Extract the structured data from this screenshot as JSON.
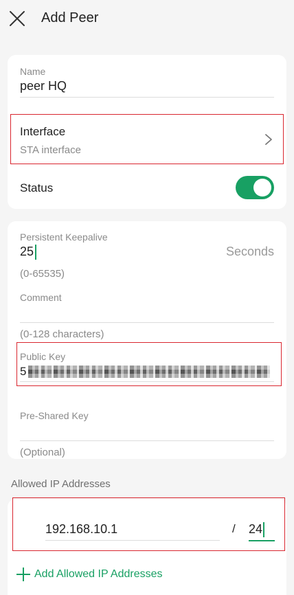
{
  "header": {
    "title": "Add Peer"
  },
  "general": {
    "name_label": "Name",
    "name_value": "peer HQ",
    "interface_label": "Interface",
    "interface_value": "STA interface",
    "status_label": "Status",
    "status_on": true
  },
  "advanced": {
    "keepalive_label": "Persistent Keepalive",
    "keepalive_value": "25",
    "keepalive_unit": "Seconds",
    "keepalive_hint": "(0-65535)",
    "comment_label": "Comment",
    "comment_value": "",
    "comment_hint": "(0-128 characters)",
    "public_key_label": "Public Key",
    "public_key_prefix": "5",
    "psk_label": "Pre-Shared Key",
    "psk_value": "",
    "psk_hint": "(Optional)"
  },
  "allowed_ips": {
    "section_title": "Allowed IP Addresses",
    "ip_value": "192.168.10.1",
    "separator": "/",
    "prefix_value": "24",
    "add_label": "Add Allowed IP Addresses"
  },
  "colors": {
    "accent": "#18a063",
    "highlight": "#d9252e",
    "card": "#ffffff",
    "background": "#f5f5f5"
  },
  "icons": {
    "close": "close-icon",
    "chevron": "chevron-right-icon",
    "plus": "plus-icon"
  }
}
